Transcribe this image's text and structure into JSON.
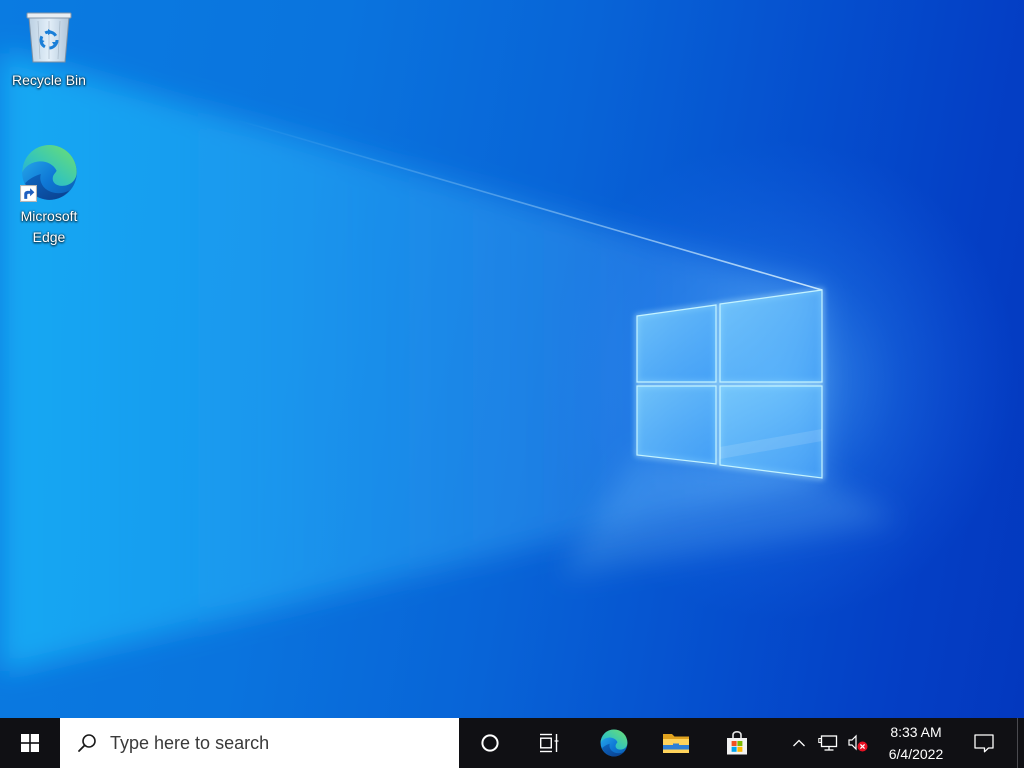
{
  "colors": {
    "taskbar_bg": "#101014",
    "search_bg": "#ffffff",
    "search_text": "#3a3a3a",
    "tray_text": "#ffffff",
    "desktop_label": "#ffffff",
    "mute_badge": "#e81123"
  },
  "desktop": {
    "icons": [
      {
        "label": "Recycle Bin",
        "icon": "recycle-bin-icon"
      },
      {
        "label": "Microsoft Edge",
        "icon": "edge-icon",
        "overlay": "shortcut-arrow-icon"
      }
    ]
  },
  "taskbar": {
    "start": {
      "icon": "windows-start-icon"
    },
    "search": {
      "icon": "search-icon",
      "placeholder": "Type here to search"
    },
    "cortana": {
      "icon": "cortana-circle-icon"
    },
    "task_view": {
      "icon": "task-view-icon"
    },
    "pinned_apps": [
      {
        "icon": "edge-icon"
      },
      {
        "icon": "file-explorer-icon"
      },
      {
        "icon": "microsoft-store-icon"
      }
    ],
    "tray": {
      "icons": [
        "chevron-up-icon",
        "network-icon",
        "volume-muted-icon"
      ],
      "clock": {
        "time": "8:33 AM",
        "date": "6/4/2022"
      },
      "notifications": {
        "icon": "action-center-icon"
      }
    }
  }
}
